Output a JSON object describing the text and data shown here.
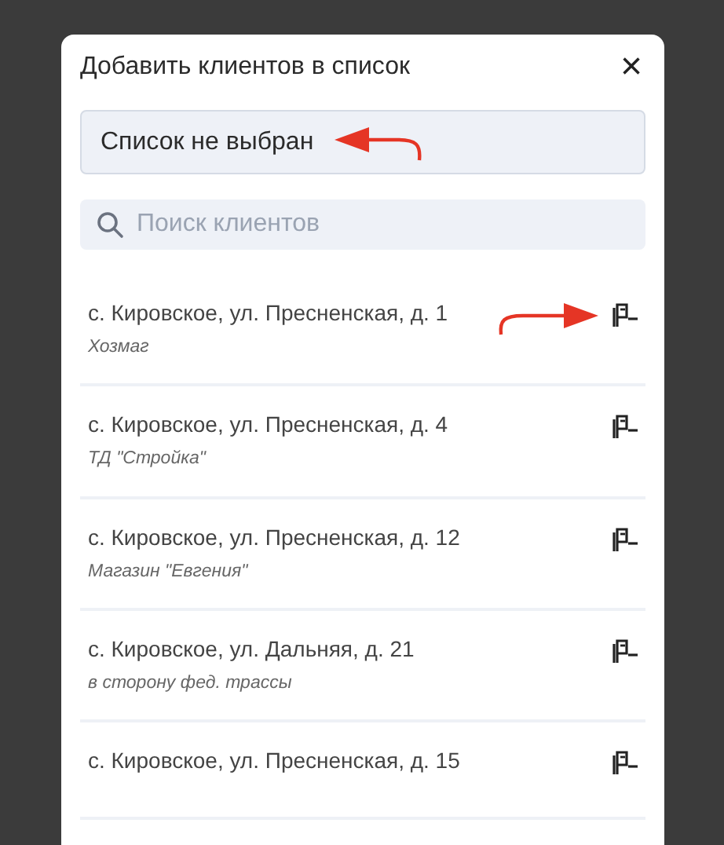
{
  "modal": {
    "title": "Добавить клиентов в список",
    "close": "×"
  },
  "list_select": {
    "value": "Список не выбран"
  },
  "search": {
    "placeholder": "Поиск клиентов"
  },
  "clients": [
    {
      "address": "с. Кировское, ул. Пресненская, д. 1",
      "note": "Хозмаг"
    },
    {
      "address": "с. Кировское, ул. Пресненская, д. 4",
      "note": "ТД \"Стройка\""
    },
    {
      "address": "с. Кировское, ул. Пресненская, д. 12",
      "note": "Магазин \"Евгения\""
    },
    {
      "address": "с. Кировское, ул. Дальняя, д. 21",
      "note": "в сторону фед. трассы"
    },
    {
      "address": "с. Кировское, ул. Пресненская, д. 15"
    }
  ]
}
